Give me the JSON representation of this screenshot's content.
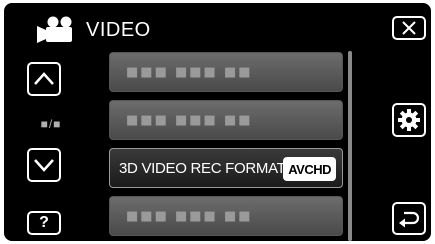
{
  "header": {
    "title": "VIDEO",
    "mode_icon": "video-camera-icon"
  },
  "nav": {
    "up_icon": "chevron-up-icon",
    "down_icon": "chevron-down-icon",
    "page_indicator": "■/■",
    "help_label": "?"
  },
  "menu": {
    "items": [
      {
        "label": "■■■ ■■■ ■■",
        "placeholder": true
      },
      {
        "label": "■■■ ■■■ ■■",
        "placeholder": true
      },
      {
        "label": "3D VIDEO REC FORMAT",
        "value": "AVCHD",
        "selected": true
      },
      {
        "label": "■■■ ■■■ ■■",
        "placeholder": true
      }
    ]
  },
  "actions": {
    "close_icon": "close-icon",
    "settings_icon": "gear-icon",
    "back_icon": "return-arrow-icon"
  },
  "colors": {
    "background": "#000000",
    "button_border": "#ffffff",
    "item_gradient_top": "#6c6c6c",
    "item_gradient_bottom": "#4a4a4a",
    "badge_bg": "#ffffff"
  }
}
